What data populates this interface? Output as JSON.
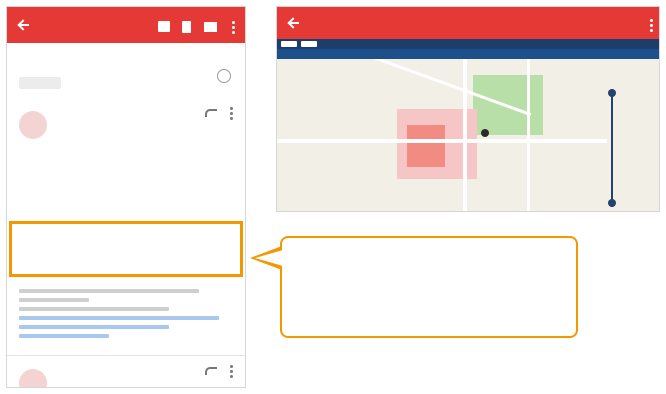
{
  "colors": {
    "toolbar_red": "#e53935",
    "highlight_orange": "#f39800",
    "link_blue": "#a9c8f0",
    "map_header_navy": "#1d4f8a"
  },
  "email_app": {
    "subject": "",
    "label": "",
    "sender_email": "",
    "recipient": "",
    "date": "",
    "details_link": "",
    "body": "",
    "detected_datetime": "",
    "vehicle": "",
    "section_location_title": "",
    "location_link": "",
    "section_contact": "",
    "phone": "",
    "section_unsubscribe": "",
    "unsubscribe_link": ""
  },
  "map_app": {
    "title": "",
    "url": "",
    "address": ""
  },
  "callout": {
    "line1": "",
    "line2": ""
  }
}
